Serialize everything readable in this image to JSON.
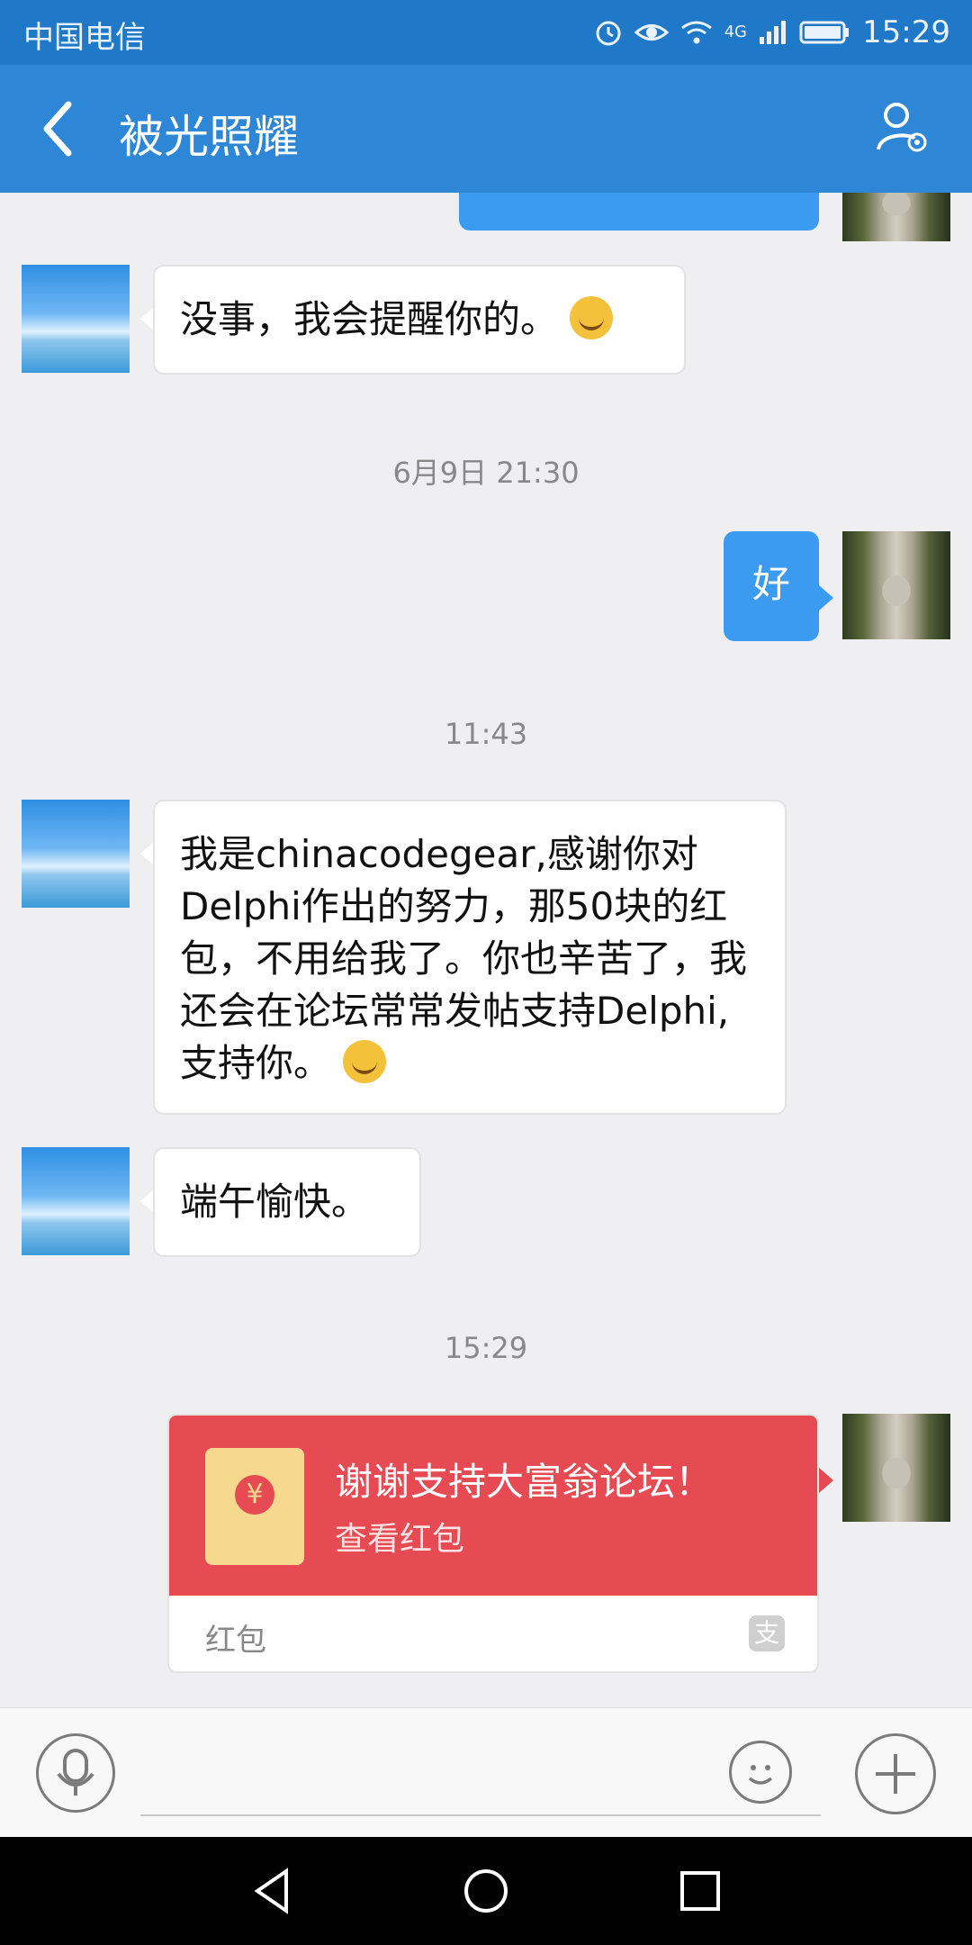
{
  "status_bar": {
    "carrier": "中国电信",
    "time": "15:29",
    "network": "4G"
  },
  "header": {
    "title": "被光照耀"
  },
  "messages": [
    {
      "from": "other",
      "text": "没事，我会提醒你的。",
      "emoji": "grin-emoji"
    },
    {
      "timestamp": "6月9日 21:30"
    },
    {
      "from": "me",
      "text": "好"
    },
    {
      "timestamp": "11:43"
    },
    {
      "from": "other",
      "text": "我是chinacodegear,感谢你对Delphi作出的努力，那50块的红包，不用给我了。你也辛苦了，我还会在论坛常常发帖支持Delphi,支持你。",
      "emoji": "smile-emoji"
    },
    {
      "from": "other",
      "text": "端午愉快。"
    },
    {
      "timestamp": "15:29"
    },
    {
      "from": "me",
      "type": "red-packet",
      "title": "谢谢支持大富翁论坛！",
      "subtitle": "查看红包",
      "footer": "红包",
      "icon_char": "¥",
      "brand_char": "支"
    }
  ],
  "input": {
    "placeholder": ""
  },
  "colors": {
    "header": "#2d86d6",
    "statusbar": "#1f78c8",
    "my_bubble": "#3a9bf1",
    "red_packet": "#e64a52"
  }
}
